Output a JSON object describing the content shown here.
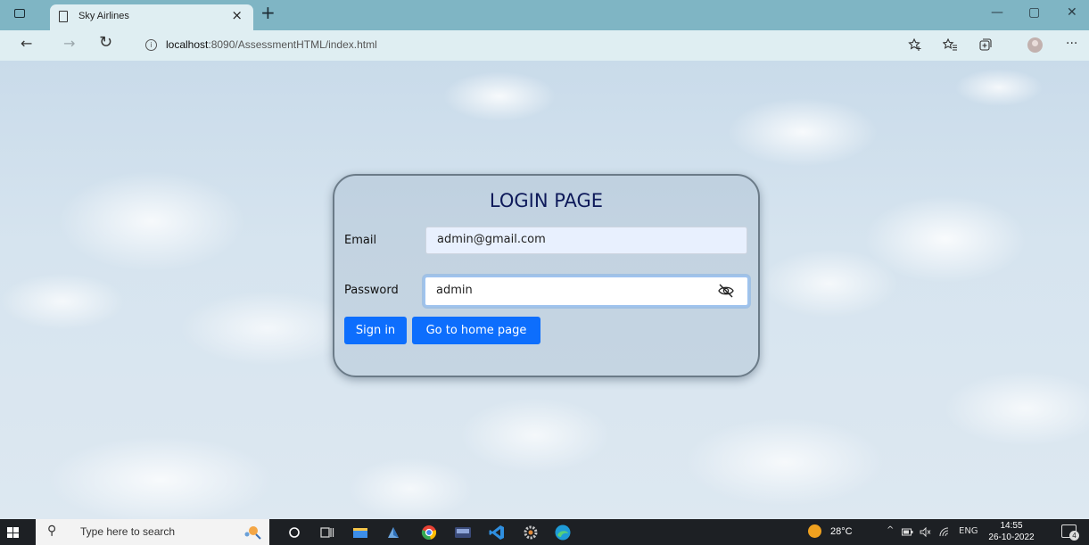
{
  "browser": {
    "tab": {
      "title": "Sky Airlines",
      "close_glyph": "×",
      "icon": "page-icon"
    },
    "new_tab_glyph": "+",
    "window_controls": {
      "minimize": "—",
      "restore": "▢",
      "close": "✕"
    },
    "nav": {
      "back": "←",
      "forward": "→",
      "refresh": "↻"
    },
    "address": {
      "info_glyph": "i",
      "host": "localhost",
      "path": ":8090/AssessmentHTML/index.html"
    },
    "toolbar_icons": [
      "add-favorite-icon",
      "favorites-icon",
      "collections-icon",
      "profile-icon",
      "more-icon"
    ],
    "more_glyph": "···"
  },
  "login": {
    "title": "LOGIN PAGE",
    "email_label": "Email",
    "email_value": "admin@gmail.com",
    "password_label": "Password",
    "password_value": "admin",
    "signin_label": "Sign in",
    "home_label": "Go to home page"
  },
  "taskbar": {
    "search_placeholder": "Type here to search",
    "search_glyph": "⚲",
    "weather_temp": "28°C",
    "tray_chevron": "^",
    "tray_volume": "🔈",
    "tray_wifi": "◠",
    "language": "ENG",
    "time": "14:55",
    "date": "26-10-2022",
    "notification_count": "4",
    "apps": [
      "cortana-icon",
      "task-view-icon",
      "file-explorer-icon",
      "app-icon",
      "chrome-icon",
      "media-icon",
      "vscode-icon",
      "settings-icon",
      "edge-icon"
    ]
  },
  "colors": {
    "accent_button": "#0d6efd",
    "title_text": "#0e1a5a",
    "browser_chrome": "#7fb5c4",
    "taskbar": "#1d2024"
  }
}
